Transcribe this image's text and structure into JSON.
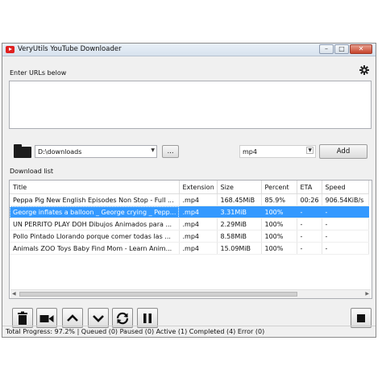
{
  "window": {
    "title": "VeryUtils YouTube Downloader",
    "controls": {
      "minimize": "–",
      "maximize": "□",
      "close": "✕"
    }
  },
  "urls": {
    "label": "Enter URLs below",
    "value": ""
  },
  "path": {
    "value": "D:\\downloads",
    "browse_label": "..."
  },
  "format": {
    "value": "mp4"
  },
  "add_label": "Add",
  "download_list": {
    "label": "Download list",
    "columns": [
      "Title",
      "Extension",
      "Size",
      "Percent",
      "ETA",
      "Speed"
    ],
    "rows": [
      {
        "title": "Peppa Pig New English Episodes Non Stop - Full ...",
        "ext": ".mp4",
        "size": "168.45MiB",
        "percent": "85.9%",
        "eta": "00:26",
        "speed": "906.54KiB/s",
        "selected": false
      },
      {
        "title": "George inflates a balloon _ George crying _ Pepp...",
        "ext": ".mp4",
        "size": "3.31MiB",
        "percent": "100%",
        "eta": "-",
        "speed": "-",
        "selected": true
      },
      {
        "title": "UN PERRITO PLAY DOH  Dibujos Animados para ...",
        "ext": ".mp4",
        "size": "2.29MiB",
        "percent": "100%",
        "eta": "-",
        "speed": "-",
        "selected": false
      },
      {
        "title": "Pollo Pintado Llorando porque comer todas las ...",
        "ext": ".mp4",
        "size": "8.58MiB",
        "percent": "100%",
        "eta": "-",
        "speed": "-",
        "selected": false
      },
      {
        "title": "Animals ZOO Toys Baby Find Mom - Learn Anim...",
        "ext": ".mp4",
        "size": "15.09MiB",
        "percent": "100%",
        "eta": "-",
        "speed": "-",
        "selected": false
      }
    ]
  },
  "toolbar_icons": [
    "trash-icon",
    "video-camera-icon",
    "arrow-up-icon",
    "arrow-down-icon",
    "reload-icon",
    "pause-icon",
    "stop-icon"
  ],
  "colors": {
    "selection": "#3399ff"
  },
  "status": "Total Progress: 97.2% | Queued (0) Paused (0) Active (1) Completed (4) Error (0)"
}
